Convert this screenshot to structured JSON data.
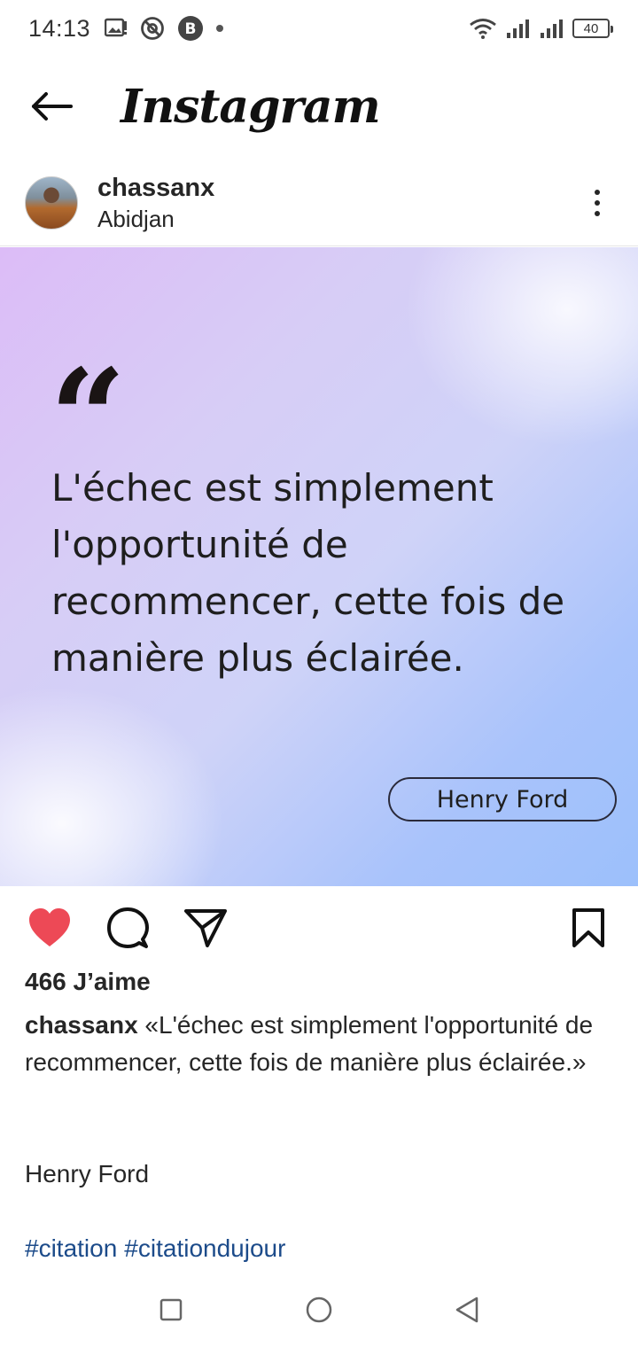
{
  "status_bar": {
    "time": "14:13",
    "battery_level": "40",
    "icons_left": [
      "gallery-notification-icon",
      "at-sign-icon",
      "b-app-icon",
      "dot-icon"
    ],
    "icons_right": [
      "wifi-icon",
      "signal-1-icon",
      "signal-2-icon",
      "battery-icon"
    ]
  },
  "app_bar": {
    "title": "Instagram",
    "back_icon": "arrow-left-icon"
  },
  "post": {
    "username": "chassanx",
    "location": "Abidjan",
    "image": {
      "quote_mark": "“",
      "quote": "L'échec est simplement l'opportunité de recommencer, cette fois de manière plus éclairée.",
      "author": "Henry Ford",
      "gradient_colors": [
        "#dcbcf7",
        "#cfd3f8",
        "#9cc0fb"
      ]
    },
    "liked": true,
    "like_color": "#ed4956",
    "likes_text": "466 J’aime",
    "caption_username": "chassanx",
    "caption_text": " «L'échec est simplement l'opportunité de recommencer, cette fois de manière plus éclairée.»",
    "caption_author": "Henry Ford",
    "hashtags": [
      "#citation",
      "#citationdujour"
    ],
    "hashtag_color": "#1c4b8a"
  },
  "nav_bar": {
    "buttons": [
      "recent-apps-icon",
      "home-icon",
      "back-triangle-icon"
    ]
  }
}
